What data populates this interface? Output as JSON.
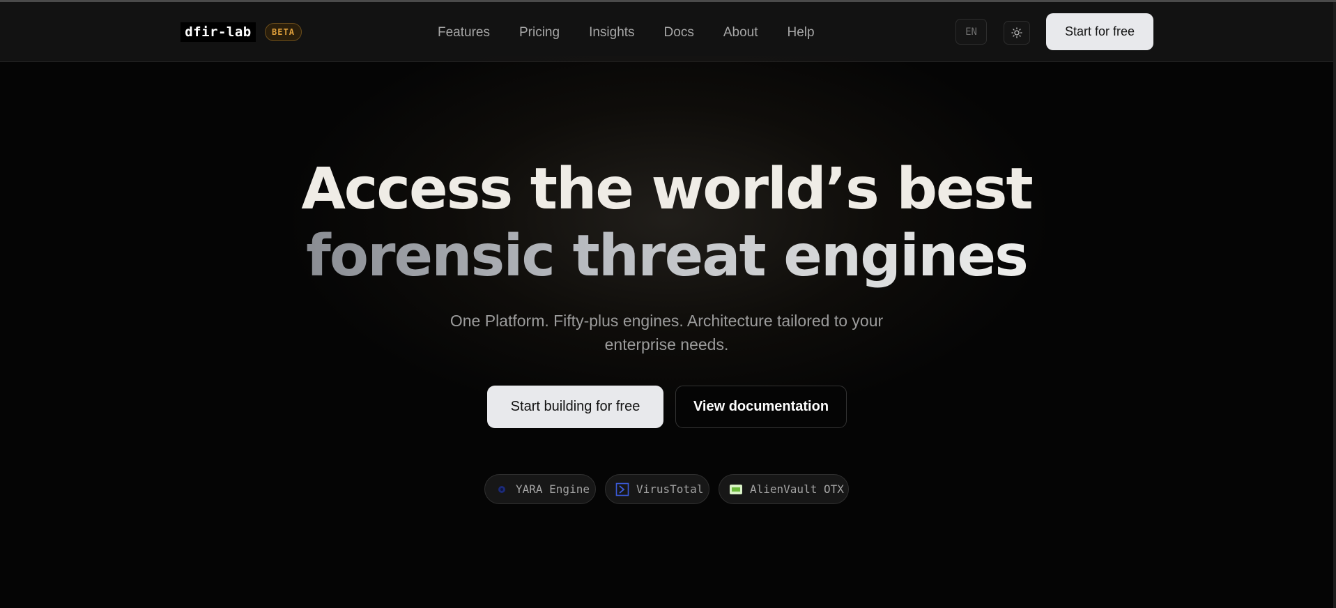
{
  "header": {
    "logo_text": "dfir-lab",
    "badge": "BETA",
    "nav": [
      "Features",
      "Pricing",
      "Insights",
      "Docs",
      "About",
      "Help"
    ],
    "lang": "EN",
    "theme_icon": "sun-icon",
    "cta": "Start for free"
  },
  "hero": {
    "title_line1": "Access the world’s best",
    "title_line2": "forensic threat engines",
    "subtitle": "One Platform. Fifty-plus engines. Architecture tailored to your enterprise needs.",
    "primary_button": "Start building for free",
    "secondary_button": "View documentation"
  },
  "engines": [
    {
      "label": "YARA Engine",
      "icon": "yara-icon"
    },
    {
      "label": "VirusTotal",
      "icon": "virustotal-icon"
    },
    {
      "label": "AlienVault OTX",
      "icon": "alienvault-icon"
    }
  ],
  "colors": {
    "background": "#050505",
    "header": "#121212",
    "accent_badge": "#e0a03c",
    "button_light": "#e8e9ec"
  }
}
